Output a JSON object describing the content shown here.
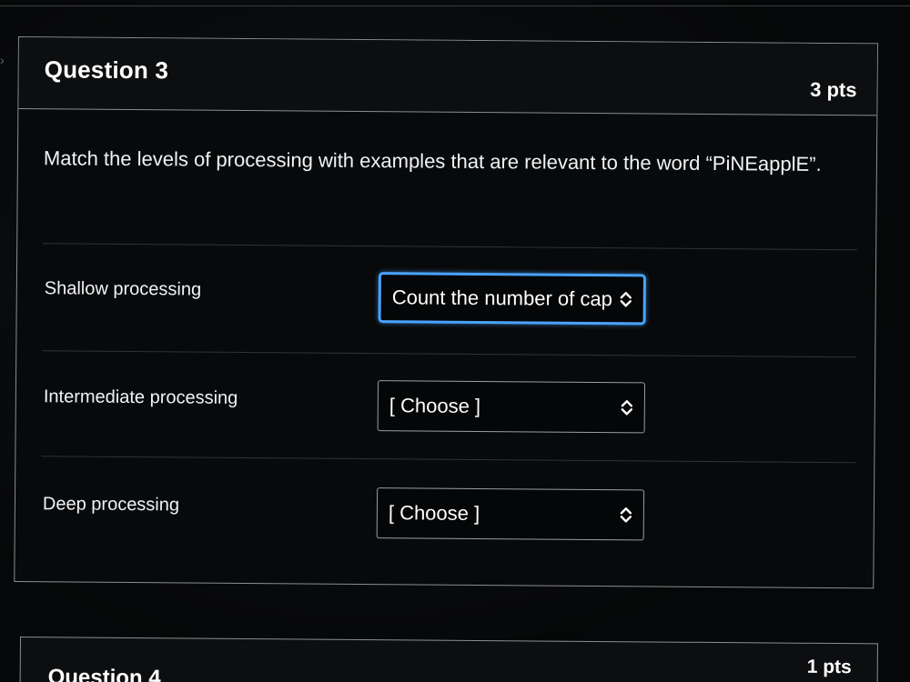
{
  "question": {
    "title": "Question 3",
    "points": "3 pts",
    "text": "Match the levels of processing with examples that are relevant to the word “PiNEapplE”."
  },
  "matches": [
    {
      "label": "Shallow processing",
      "selected": "Count the number of capital letters"
    },
    {
      "label": "Intermediate processing",
      "selected": "[ Choose ]"
    },
    {
      "label": "Deep processing",
      "selected": "[ Choose ]"
    }
  ],
  "next_question": {
    "title": "Question 4",
    "points": "1 pts"
  },
  "colors": {
    "focus_border": "#4aa3ff",
    "card_border": "#8a8e92",
    "background": "#050607"
  },
  "icons": {
    "select_arrows": "updown-chevron-icon",
    "sidebar_toggle": "chevron-right-icon"
  }
}
